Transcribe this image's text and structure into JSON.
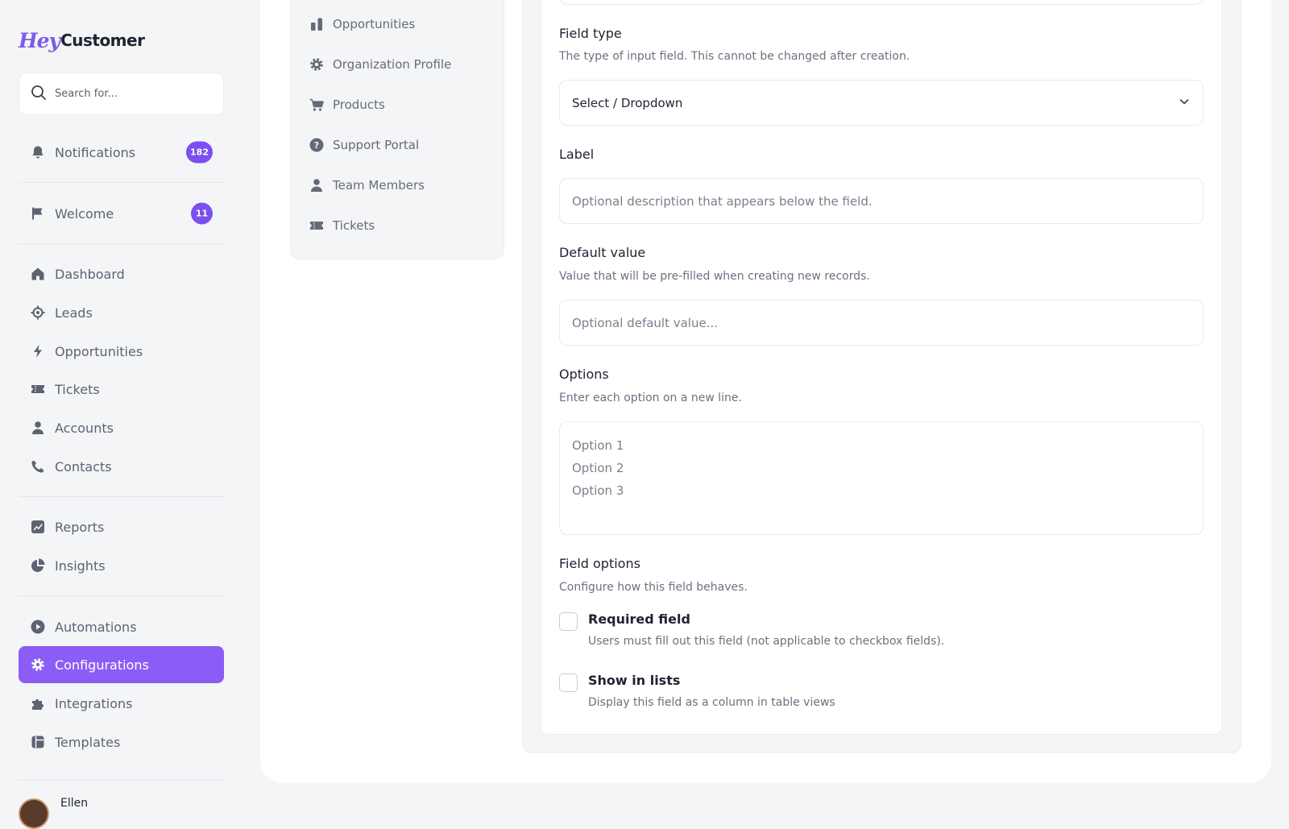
{
  "brand": {
    "hey": "Hey",
    "customer": "Customer"
  },
  "search": {
    "placeholder": "Search for..."
  },
  "sidebar": {
    "notifications": {
      "label": "Notifications",
      "badge": "182"
    },
    "welcome": {
      "label": "Welcome",
      "badge": "11"
    },
    "items": [
      {
        "label": "Dashboard",
        "icon": "home-icon"
      },
      {
        "label": "Leads",
        "icon": "crosshair-icon"
      },
      {
        "label": "Opportunities",
        "icon": "bolt-icon"
      },
      {
        "label": "Tickets",
        "icon": "ticket-icon"
      },
      {
        "label": "Accounts",
        "icon": "person-icon"
      },
      {
        "label": "Contacts",
        "icon": "phone-icon"
      },
      {
        "label": "Reports",
        "icon": "chart-icon"
      },
      {
        "label": "Insights",
        "icon": "pie-icon"
      },
      {
        "label": "Automations",
        "icon": "play-icon"
      },
      {
        "label": "Configurations",
        "icon": "gear-icon"
      },
      {
        "label": "Integrations",
        "icon": "puzzle-icon"
      },
      {
        "label": "Templates",
        "icon": "template-icon"
      }
    ],
    "active": "Configurations",
    "accent": "#8b5cf6"
  },
  "user": {
    "name": "Ellen"
  },
  "subnav": {
    "items": [
      {
        "label": "Opportunities",
        "icon": "bar-chart-icon"
      },
      {
        "label": "Organization Profile",
        "icon": "gear-icon"
      },
      {
        "label": "Products",
        "icon": "cart-icon"
      },
      {
        "label": "Support Portal",
        "icon": "help-icon"
      },
      {
        "label": "Team Members",
        "icon": "person-icon"
      },
      {
        "label": "Tickets",
        "icon": "ticket-icon"
      }
    ]
  },
  "form": {
    "field_type": {
      "title": "Field type",
      "description": "The type of input field. This cannot be changed after creation.",
      "value": "Select / Dropdown"
    },
    "label": {
      "title": "Label",
      "placeholder": "Optional description that appears below the field."
    },
    "default_value": {
      "title": "Default value",
      "description": "Value that will be pre-filled when creating new records.",
      "placeholder": "Optional default value..."
    },
    "options": {
      "title": "Options",
      "description": "Enter each option on a new line.",
      "placeholder": "Option 1\nOption 2\nOption 3"
    },
    "field_options": {
      "title": "Field options",
      "description": "Configure how this field behaves.",
      "required": {
        "label": "Required field",
        "description": "Users must fill out this field (not applicable to checkbox fields).",
        "checked": false
      },
      "show_in_lists": {
        "label": "Show in lists",
        "description": "Display this field as a column in table views",
        "checked": false
      }
    }
  }
}
